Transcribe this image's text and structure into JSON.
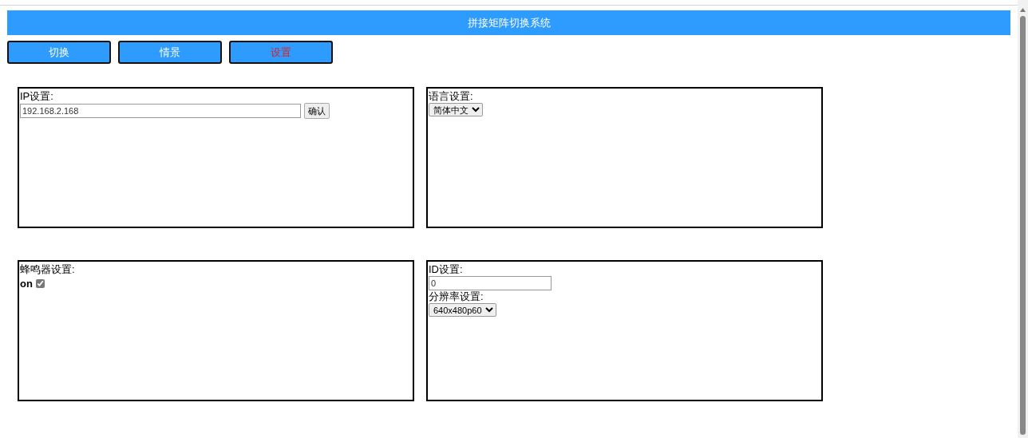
{
  "title": "拼接矩阵切换系统",
  "tabs": [
    {
      "label": "切换",
      "selected": false
    },
    {
      "label": "情景",
      "selected": false
    },
    {
      "label": "设置",
      "selected": true
    }
  ],
  "panels": [
    {
      "items": [
        {
          "kind": "label",
          "text": "IP设置:"
        },
        {
          "kind": "text",
          "value": "192.168.2.168"
        },
        {
          "kind": "button",
          "text": "确认"
        }
      ]
    },
    {
      "items": [
        {
          "kind": "label",
          "text": "语言设置:"
        },
        {
          "kind": "select",
          "value": "简体中文"
        }
      ]
    },
    {
      "items": [
        {
          "kind": "label",
          "text": "蜂鸣器设置:"
        },
        {
          "kind": "checkbox",
          "text": "on",
          "checked": true
        }
      ]
    },
    {
      "items": [
        {
          "kind": "label",
          "text": "ID设置:"
        },
        {
          "kind": "text",
          "value": "0"
        },
        {
          "kind": "label",
          "text": "分辨率设置:"
        },
        {
          "kind": "select",
          "value": "640x480p60"
        }
      ]
    }
  ]
}
